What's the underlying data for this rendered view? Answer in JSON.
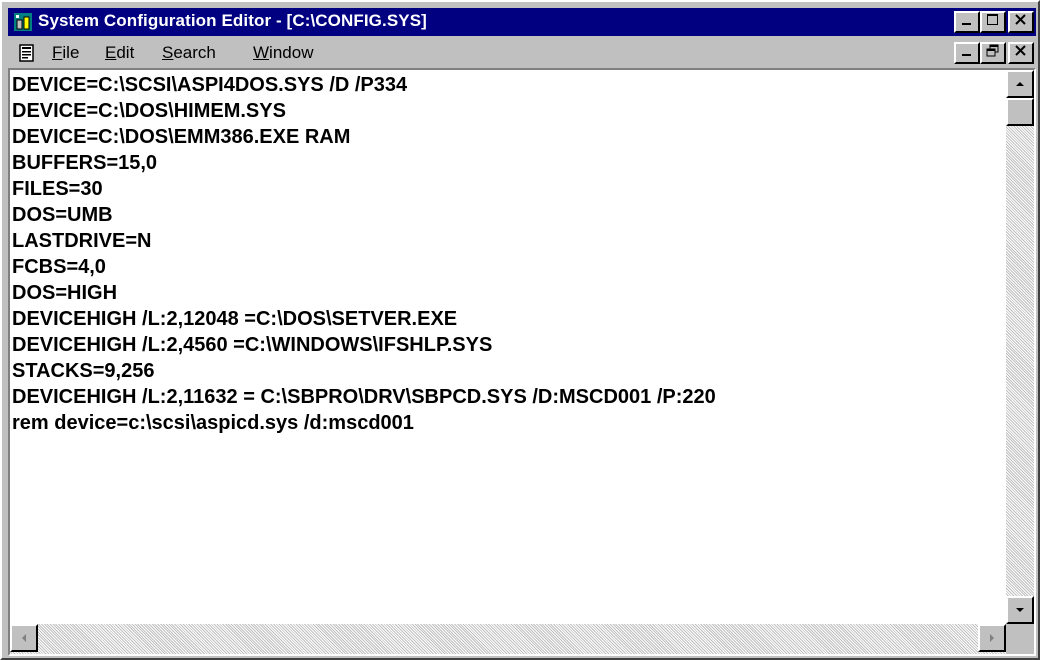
{
  "window": {
    "title": "System Configuration Editor - [C:\\CONFIG.SYS]",
    "icon": "sysedit-icon"
  },
  "menu": {
    "items": [
      {
        "label": "File",
        "mnemonic": "F",
        "rest": "ile"
      },
      {
        "label": "Edit",
        "mnemonic": "E",
        "rest": "dit"
      },
      {
        "label": "Search",
        "mnemonic": "S",
        "rest": "earch"
      },
      {
        "label": "Window",
        "mnemonic": "W",
        "rest": "indow"
      }
    ]
  },
  "document": {
    "lines": [
      "DEVICE=C:\\SCSI\\ASPI4DOS.SYS /D /P334",
      "DEVICE=C:\\DOS\\HIMEM.SYS",
      "DEVICE=C:\\DOS\\EMM386.EXE RAM",
      "BUFFERS=15,0",
      "FILES=30",
      "DOS=UMB",
      "LASTDRIVE=N",
      "FCBS=4,0",
      "DOS=HIGH",
      "DEVICEHIGH /L:2,12048 =C:\\DOS\\SETVER.EXE",
      "DEVICEHIGH /L:2,4560 =C:\\WINDOWS\\IFSHLP.SYS",
      "STACKS=9,256",
      "DEVICEHIGH /L:2,11632 = C:\\SBPRO\\DRV\\SBPCD.SYS /D:MSCD001 /P:220",
      "rem device=c:\\scsi\\aspicd.sys /d:mscd001"
    ]
  },
  "colors": {
    "titlebar": "#000080",
    "face": "#c0c0c0",
    "text": "#000000",
    "background": "#ffffff"
  }
}
